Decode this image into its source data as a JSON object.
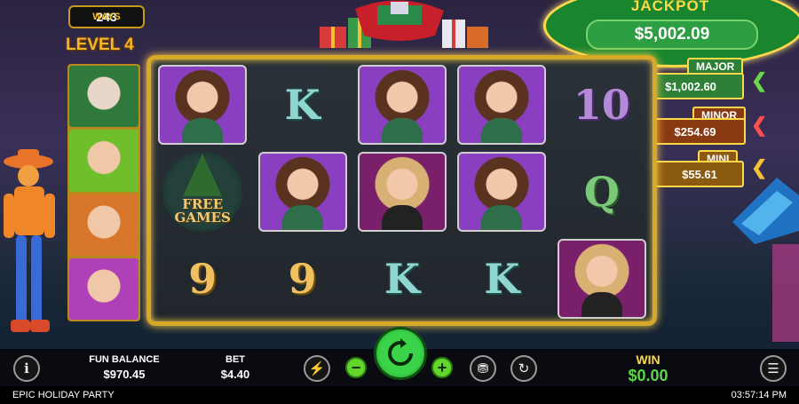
{
  "ways": {
    "count": "243",
    "label": "WAYS"
  },
  "level": "LEVEL 4",
  "jackpot": {
    "title": "JACKPOT",
    "value": "$5,002.09",
    "major": {
      "label": "MAJOR",
      "value": "$1,002.60"
    },
    "minor": {
      "label": "MINOR",
      "value": "$254.69"
    },
    "mini": {
      "label": "MINI",
      "value": "$55.61"
    }
  },
  "reels": {
    "symbols": [
      [
        "brunette",
        "K",
        "brunette",
        "brunette",
        "10"
      ],
      [
        "free_games",
        "brunette",
        "blonde",
        "brunette",
        "Q"
      ],
      [
        "9",
        "9",
        "K",
        "K",
        "blonde"
      ]
    ],
    "free_games_line1": "FREE",
    "free_games_line2": "GAMES"
  },
  "footer": {
    "fun_balance_label": "FUN BALANCE",
    "fun_balance_value": "$970.45",
    "bet_label": "BET",
    "bet_value": "$4.40",
    "win_label": "WIN",
    "win_value": "$0.00"
  },
  "status": {
    "game_title": "EPIC HOLIDAY PARTY",
    "clock": "03:57:14 PM"
  },
  "colors": {
    "frame_gold": "#d7a928",
    "spin_green": "#3bd34a",
    "jackpot_green": "#19862f"
  }
}
